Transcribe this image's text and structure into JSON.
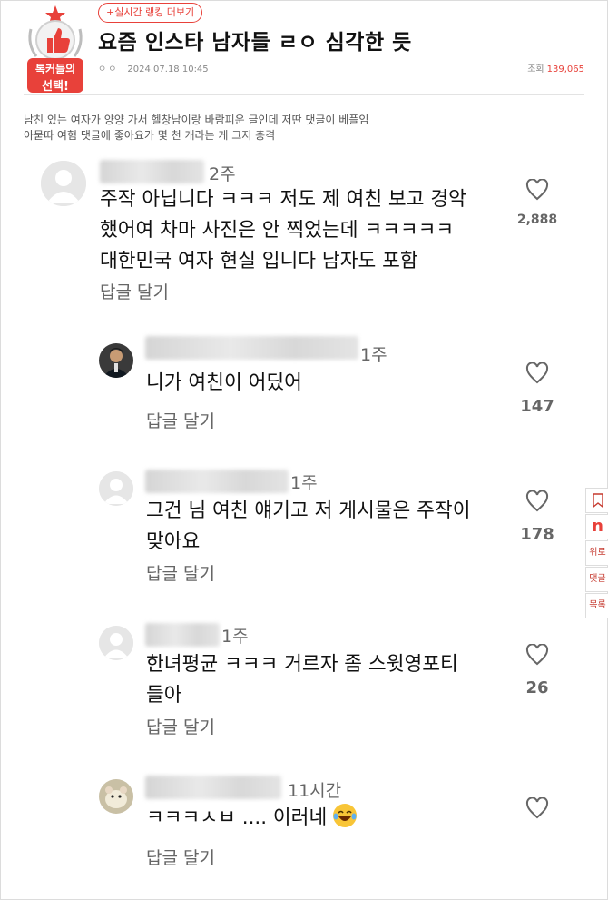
{
  "header": {
    "badge_text_1": "톡커들의",
    "badge_text_2": "선택!",
    "rank_link": "+실시간 랭킹 더보기",
    "title": "요즘 인스타 남자들 ㄹㅇ 심각한 듯",
    "author": "ㅇㅇ",
    "date": "2024.07.18 10:45",
    "views_label": "조회",
    "views_count": "139,065"
  },
  "post": {
    "lines": [
      "남친 있는 여자가 양양 가서 헬창남이랑 바람피운 글인데 저딴 댓글이 베플임",
      "아묻따 여혐 댓글에 좋아요가 몇 천 개라는 게 그저 충격"
    ]
  },
  "comments": [
    {
      "time": "2주",
      "lines": [
        "주작 아닙니다 ㅋㅋㅋ 저도 제 여친 보고 경악",
        "했어여 차마 사진은 안 찍었는데 ㅋㅋㅋㅋㅋ",
        "대한민국 여자 현실 입니다 남자도 포함"
      ],
      "reply_label": "답글 달기",
      "likes": "2,888"
    },
    {
      "time": "1주",
      "lines": [
        "니가 여친이 어딨어"
      ],
      "reply_label": "답글 달기",
      "likes": "147"
    },
    {
      "time": "1주",
      "lines": [
        "그건 님 여친 얘기고 저 게시물은 주작이",
        "맞아요"
      ],
      "reply_label": "답글 달기",
      "likes": "178"
    },
    {
      "time": "1주",
      "lines": [
        "한녀평균 ㅋㅋㅋ 거르자 좀 스윗영포티",
        "들아"
      ],
      "reply_label": "답글 달기",
      "likes": "26"
    },
    {
      "time": "11시간",
      "lines": [
        "ㅋㅋㅋㅅㅂ .... 이러네"
      ],
      "reply_label": "답글 달기",
      "likes": ""
    }
  ],
  "side_rail": {
    "item_n": "n",
    "top": "위로",
    "comments": "댓글",
    "list": "목록"
  },
  "icons": [
    "badge-thumbs-up-icon",
    "heart-icon",
    "default-avatar-icon",
    "laughing-emoji-icon",
    "bookmark-icon"
  ],
  "colors": {
    "accent": "#e8413a",
    "text": "#111111",
    "muted": "#666666"
  }
}
